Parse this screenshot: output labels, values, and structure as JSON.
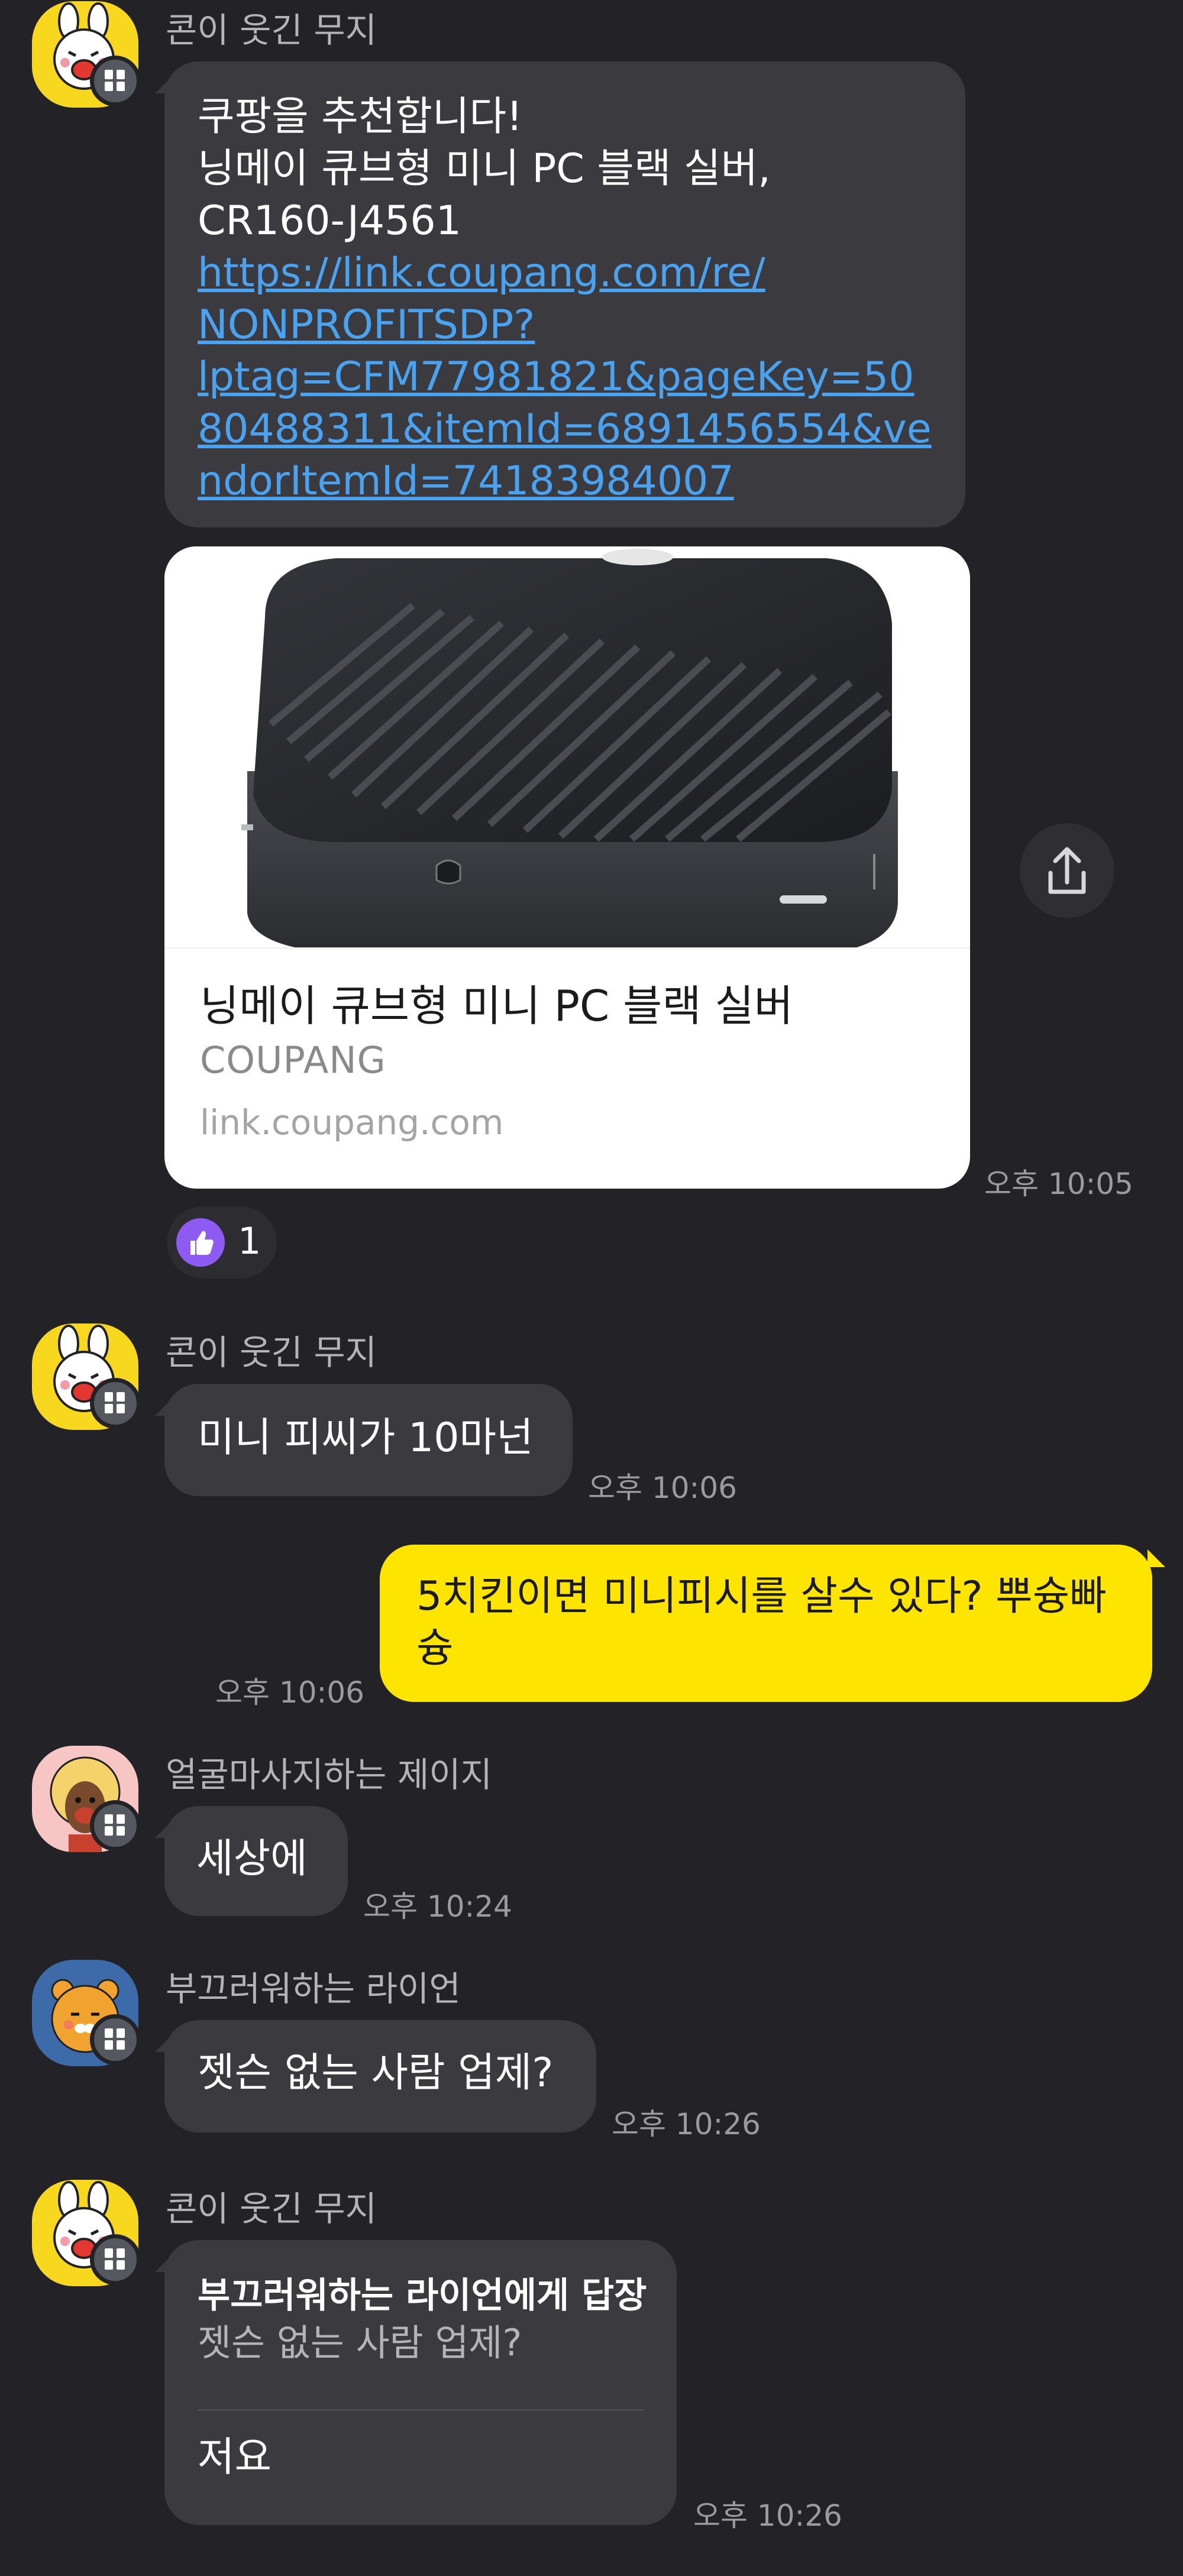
{
  "messages": {
    "m1": {
      "sender": "콘이 웃긴 무지",
      "lines": [
        "쿠팡을 추천합니다!",
        "닝메이 큐브형 미니 PC 블랙 실버,",
        "CR160-J4561"
      ],
      "link_lines": [
        "https://link.coupang.com/re/",
        "NONPROFITSDP?",
        "lptag=CFM77981821&pageKey=50",
        "80488311&itemId=6891456554&ve",
        "ndorItemId=74183984007"
      ],
      "card": {
        "title": "닝메이 큐브형 미니 PC 블랙 실버",
        "source": "COUPANG",
        "domain": "link.coupang.com"
      },
      "time": "오후 10:05",
      "reaction_count": "1"
    },
    "m2": {
      "sender": "콘이 웃긴 무지",
      "text": "미니 피씨가 10마넌",
      "time": "오후 10:06"
    },
    "m3": {
      "text_line1": "5치킨이면 미니피시를 살수 있다? 뿌슝빠",
      "text_line2": "슝",
      "time": "오후 10:06"
    },
    "m4": {
      "sender": "얼굴마사지하는 제이지",
      "text": "세상에",
      "time": "오후 10:24"
    },
    "m5": {
      "sender": "부끄러워하는 라이언",
      "text": "젯슨 없는 사람 업제?",
      "time": "오후 10:26"
    },
    "m6": {
      "sender": "콘이 웃긴 무지",
      "reply_to": "부끄러워하는 라이언에게 답장",
      "quoted": "젯슨 없는 사람 업제?",
      "text": "저요",
      "time": "오후 10:26"
    }
  },
  "colors": {
    "background": "#232327",
    "bubble_other": "#3a3a3f",
    "bubble_me": "#fee500",
    "link": "#4aa3f0",
    "reaction": "#8e5bf2"
  },
  "icons": {
    "share": "share-icon",
    "thumbs_up": "thumbs-up-icon",
    "badge": "chat-badge-icon"
  }
}
